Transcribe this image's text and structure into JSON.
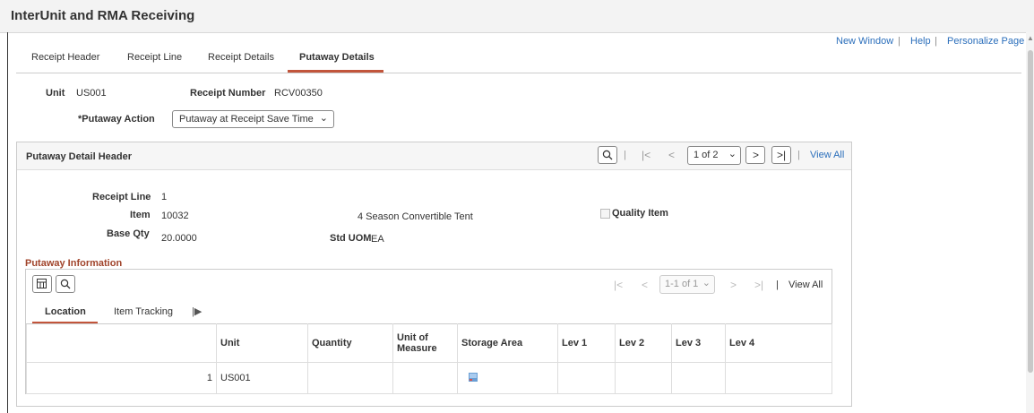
{
  "app": {
    "title": "InterUnit and RMA Receiving"
  },
  "top_links": {
    "new_window": "New Window",
    "help": "Help",
    "personalize": "Personalize Page",
    "sep": "|"
  },
  "tabs": [
    {
      "label": "Receipt Header"
    },
    {
      "label": "Receipt Line"
    },
    {
      "label": "Receipt Details"
    },
    {
      "label": "Putaway Details",
      "active": true
    }
  ],
  "form": {
    "unit_label": "Unit",
    "unit_value": "US001",
    "receipt_number_label": "Receipt Number",
    "receipt_number_value": "RCV00350",
    "putaway_action_label": "*Putaway Action",
    "putaway_action_value": "Putaway at Receipt Save Time"
  },
  "detail_header": {
    "title": "Putaway Detail Header",
    "pager": {
      "value": "1 of 2",
      "view_all": "View All",
      "sep": "|"
    },
    "receipt_line_label": "Receipt Line",
    "receipt_line_value": "1",
    "item_label": "Item",
    "item_value": "10032",
    "item_description": "4 Season Convertible Tent",
    "quality_item_label": "Quality Item",
    "quality_item_checked": false,
    "base_qty_label": "Base Qty",
    "base_qty_value": "20.0000",
    "std_uom_label": "Std UOM",
    "std_uom_value": "EA"
  },
  "putaway_info": {
    "title": "Putaway Information",
    "pager": {
      "value": "1-1 of 1",
      "view_all": "View All",
      "sep": "|"
    },
    "subtabs": [
      {
        "label": "Location",
        "active": true
      },
      {
        "label": "Item Tracking"
      }
    ],
    "columns": [
      "",
      "Unit",
      "Quantity",
      "Unit of Measure",
      "Storage Area",
      "Lev 1",
      "Lev 2",
      "Lev 3",
      "Lev 4"
    ],
    "rows": [
      {
        "num": "1",
        "unit": "US001",
        "quantity": "",
        "uom": "",
        "lev1": "",
        "lev2": "",
        "lev3": "",
        "lev4": ""
      }
    ]
  },
  "colors": {
    "accent": "#c2553b",
    "link": "#2a6ebb",
    "section_title": "#a0432a"
  }
}
